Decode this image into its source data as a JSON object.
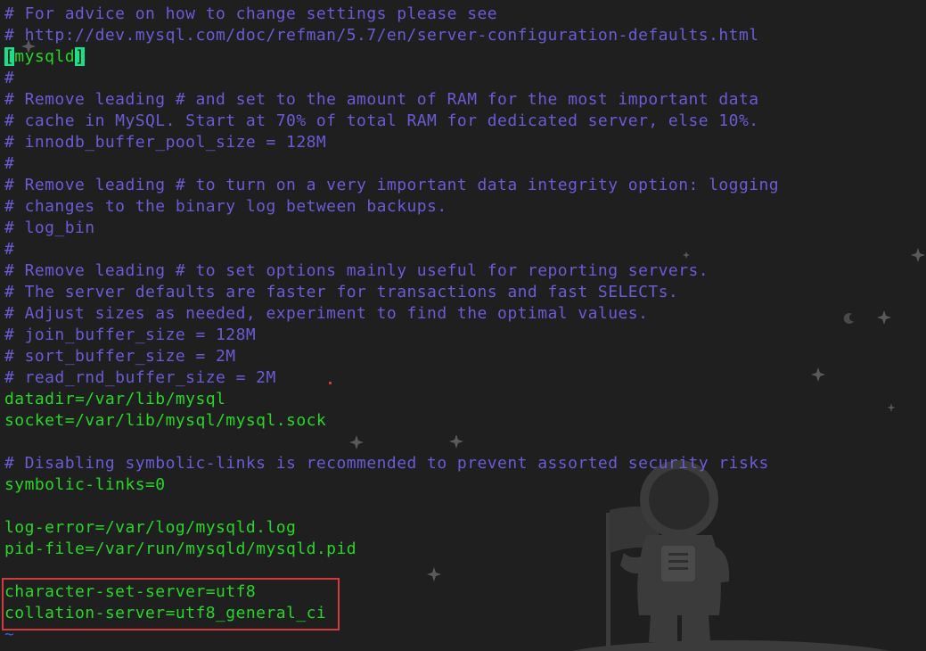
{
  "editor": {
    "section_open": "[",
    "section_name": "mysqld",
    "section_close": "]",
    "lines": [
      {
        "kind": "comment",
        "text": "# For advice on how to change settings please see"
      },
      {
        "kind": "comment",
        "text": "# http://dev.mysql.com/doc/refman/5.7/en/server-configuration-defaults.html"
      },
      {
        "kind": "section",
        "text": ""
      },
      {
        "kind": "comment",
        "text": "#"
      },
      {
        "kind": "comment",
        "text": "# Remove leading # and set to the amount of RAM for the most important data"
      },
      {
        "kind": "comment",
        "text": "# cache in MySQL. Start at 70% of total RAM for dedicated server, else 10%."
      },
      {
        "kind": "comment",
        "text": "# innodb_buffer_pool_size = 128M"
      },
      {
        "kind": "comment",
        "text": "#"
      },
      {
        "kind": "comment",
        "text": "# Remove leading # to turn on a very important data integrity option: logging"
      },
      {
        "kind": "comment",
        "text": "# changes to the binary log between backups."
      },
      {
        "kind": "comment",
        "text": "# log_bin"
      },
      {
        "kind": "comment",
        "text": "#"
      },
      {
        "kind": "comment",
        "text": "# Remove leading # to set options mainly useful for reporting servers."
      },
      {
        "kind": "comment",
        "text": "# The server defaults are faster for transactions and fast SELECTs."
      },
      {
        "kind": "comment",
        "text": "# Adjust sizes as needed, experiment to find the optimal values."
      },
      {
        "kind": "comment",
        "text": "# join_buffer_size = 128M"
      },
      {
        "kind": "comment",
        "text": "# sort_buffer_size = 2M"
      },
      {
        "kind": "comment",
        "text": "# read_rnd_buffer_size = 2M"
      },
      {
        "kind": "setting",
        "text": "datadir=/var/lib/mysql"
      },
      {
        "kind": "setting",
        "text": "socket=/var/lib/mysql/mysql.sock"
      },
      {
        "kind": "blank",
        "text": ""
      },
      {
        "kind": "comment",
        "text": "# Disabling symbolic-links is recommended to prevent assorted security risks"
      },
      {
        "kind": "setting",
        "text": "symbolic-links=0"
      },
      {
        "kind": "blank",
        "text": ""
      },
      {
        "kind": "setting",
        "text": "log-error=/var/log/mysqld.log"
      },
      {
        "kind": "setting",
        "text": "pid-file=/var/run/mysqld/mysqld.pid"
      },
      {
        "kind": "blank",
        "text": ""
      },
      {
        "kind": "setting",
        "text": "character-set-server=utf8"
      },
      {
        "kind": "setting",
        "text": "collation-server=utf8_general_ci"
      },
      {
        "kind": "tilde",
        "text": "~"
      }
    ]
  },
  "colors": {
    "background": "#1f1f1f",
    "comment": "#6a5bd6",
    "setting": "#27d627",
    "cursor": "#19e08a",
    "highlight_border": "#d23b3b",
    "wallpaper_figure": "#3a3a3a"
  }
}
